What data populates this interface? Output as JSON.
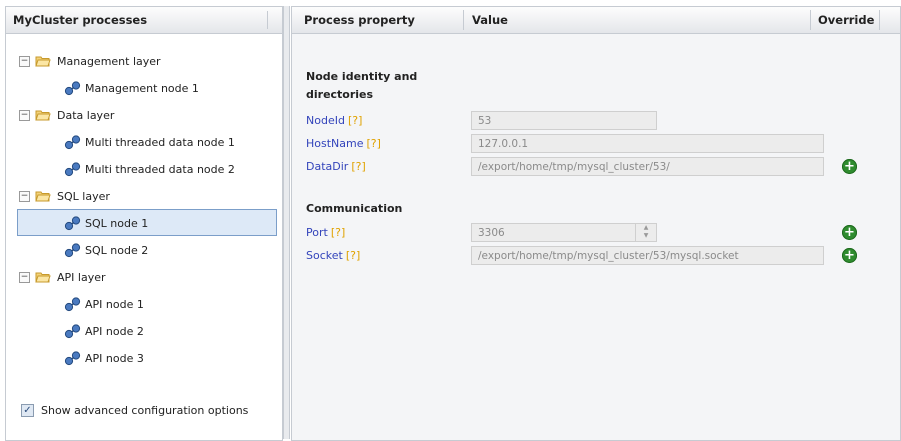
{
  "left_panel": {
    "title": "MyCluster processes",
    "tree": {
      "management_layer": {
        "label": "Management layer",
        "toggle": "−",
        "nodes": [
          "Management node 1"
        ]
      },
      "data_layer": {
        "label": "Data layer",
        "toggle": "−",
        "nodes": [
          "Multi threaded data node 1",
          "Multi threaded data node 2"
        ]
      },
      "sql_layer": {
        "label": "SQL layer",
        "toggle": "−",
        "nodes": [
          "SQL node 1",
          "SQL node 2"
        ]
      },
      "api_layer": {
        "label": "API layer",
        "toggle": "−",
        "nodes": [
          "API node 1",
          "API node 2",
          "API node 3"
        ]
      }
    },
    "selected_node": "SQL node 1",
    "advanced_option": {
      "label": "Show advanced configuration options",
      "checked": true,
      "mark": "✓"
    }
  },
  "right_panel": {
    "columns": {
      "property": "Process property",
      "value": "Value",
      "override": "Override"
    },
    "help_marker": "[?]",
    "sections": {
      "identity": {
        "title_line1": "Node identity and",
        "title_line2": "directories"
      },
      "communication": {
        "title": "Communication"
      }
    },
    "properties": {
      "nodeid": {
        "name": "NodeId",
        "value": "53"
      },
      "hostname": {
        "name": "HostName",
        "value": "127.0.0.1"
      },
      "datadir": {
        "name": "DataDir",
        "value": "/export/home/tmp/mysql_cluster/53/",
        "override_icon": "+"
      },
      "port": {
        "name": "Port",
        "value": "3306",
        "override_icon": "+"
      },
      "socket": {
        "name": "Socket",
        "value": "/export/home/tmp/mysql_cluster/53/mysql.socket",
        "override_icon": "+"
      }
    }
  },
  "colors": {
    "link_blue": "#3344bb",
    "help_orange": "#e0a200",
    "override_green": "#2f8c2f",
    "selection_bg": "#dde9f7"
  }
}
